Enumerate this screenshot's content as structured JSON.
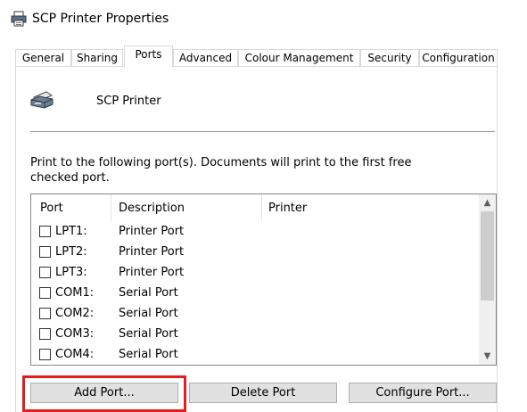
{
  "window": {
    "title": "SCP Printer Properties",
    "icon": "printer-icon"
  },
  "tabs": [
    {
      "label": "General",
      "active": false
    },
    {
      "label": "Sharing",
      "active": false
    },
    {
      "label": "Ports",
      "active": true
    },
    {
      "label": "Advanced",
      "active": false
    },
    {
      "label": "Colour Management",
      "active": false
    },
    {
      "label": "Security",
      "active": false
    },
    {
      "label": "Configuration",
      "active": false
    }
  ],
  "printer": {
    "name": "SCP Printer",
    "icon": "printer-icon"
  },
  "instructions": "Print to the following port(s). Documents will print to the first free checked port.",
  "port_list": {
    "columns": [
      "Port",
      "Description",
      "Printer"
    ],
    "rows": [
      {
        "port": "LPT1:",
        "description": "Printer Port",
        "printer": "",
        "checked": false
      },
      {
        "port": "LPT2:",
        "description": "Printer Port",
        "printer": "",
        "checked": false
      },
      {
        "port": "LPT3:",
        "description": "Printer Port",
        "printer": "",
        "checked": false
      },
      {
        "port": "COM1:",
        "description": "Serial Port",
        "printer": "",
        "checked": false
      },
      {
        "port": "COM2:",
        "description": "Serial Port",
        "printer": "",
        "checked": false
      },
      {
        "port": "COM3:",
        "description": "Serial Port",
        "printer": "",
        "checked": false
      },
      {
        "port": "COM4:",
        "description": "Serial Port",
        "printer": "",
        "checked": false
      }
    ]
  },
  "buttons": {
    "add_port": "Add Port...",
    "delete_port": "Delete Port",
    "configure_port": "Configure Port..."
  },
  "colors": {
    "highlight": "#e02020",
    "button_face": "#e1e1e1"
  }
}
